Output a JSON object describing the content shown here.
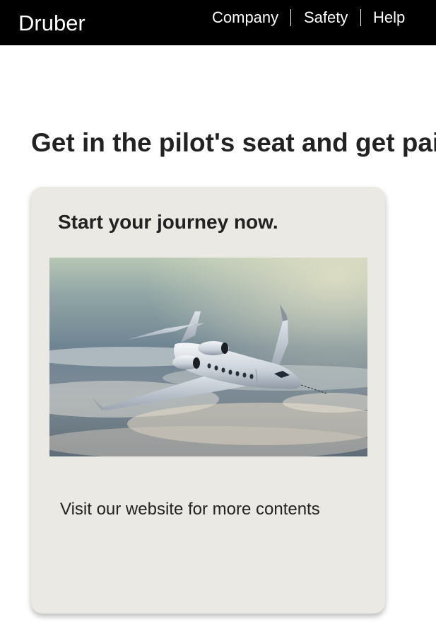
{
  "header": {
    "brand": "Druber",
    "nav": [
      {
        "label": "Company"
      },
      {
        "label": "Safety"
      },
      {
        "label": "Help"
      }
    ]
  },
  "main": {
    "headline": "Get in the pilot's seat and get paid",
    "card": {
      "title": "Start your journey now.",
      "image_subject": "business jet flying above clouds",
      "body": "Visit our website for more contents"
    }
  },
  "colors": {
    "header_bg": "#000000",
    "header_text": "#ffffff",
    "card_bg": "#ebe9e4",
    "text": "#222222"
  }
}
